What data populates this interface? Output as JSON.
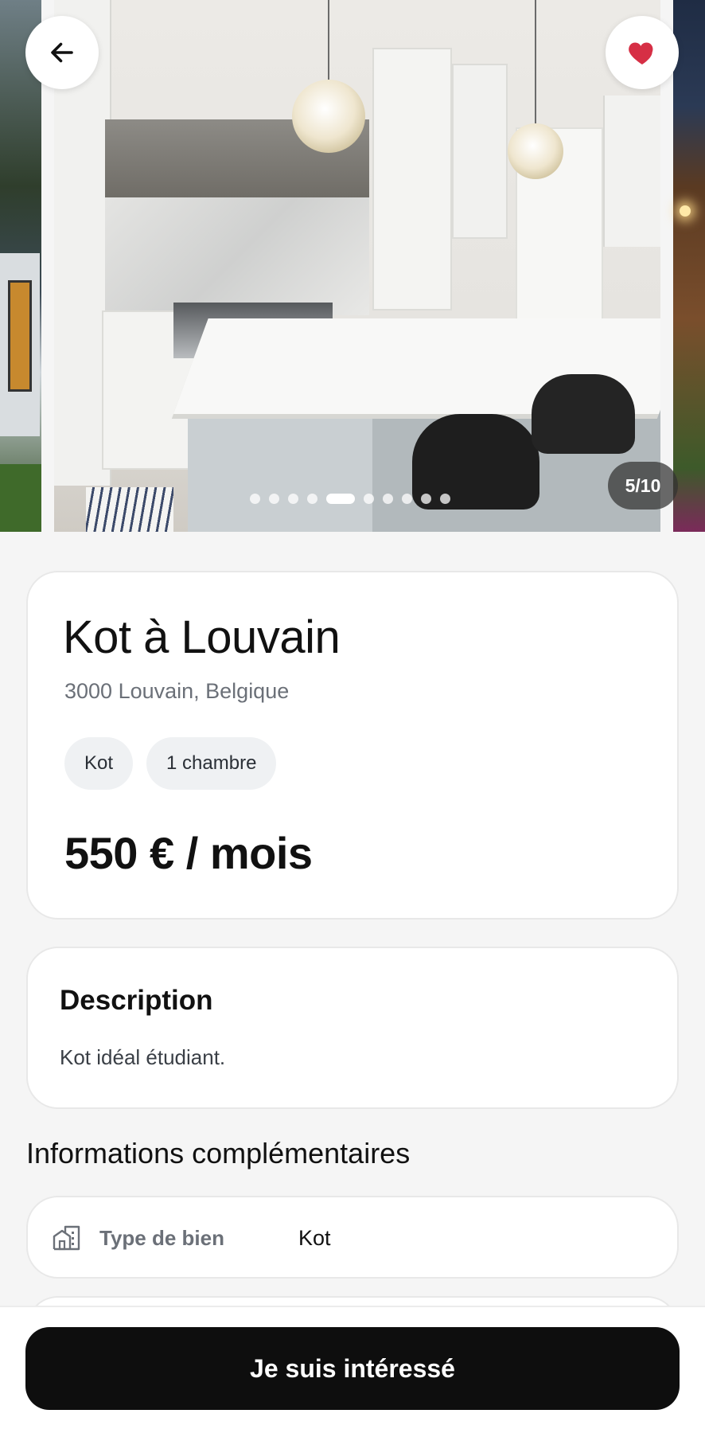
{
  "gallery": {
    "counter": "5/10",
    "dots_total": 10,
    "active_dot_index": 4,
    "favorite_color": "#d62f45"
  },
  "listing": {
    "title": "Kot à Louvain",
    "address": "3000 Louvain, Belgique",
    "chips": [
      "Kot",
      "1 chambre"
    ],
    "price": "550 € / mois"
  },
  "description": {
    "heading": "Description",
    "text": "Kot idéal étudiant."
  },
  "additional_info": {
    "heading": "Informations complémentaires",
    "rows": [
      {
        "icon": "building-icon",
        "label": "Type de bien",
        "value": "Kot"
      }
    ]
  },
  "cta": {
    "label": "Je suis intéressé"
  },
  "icons": {
    "back": "arrow-left-icon",
    "favorite": "heart-icon"
  }
}
